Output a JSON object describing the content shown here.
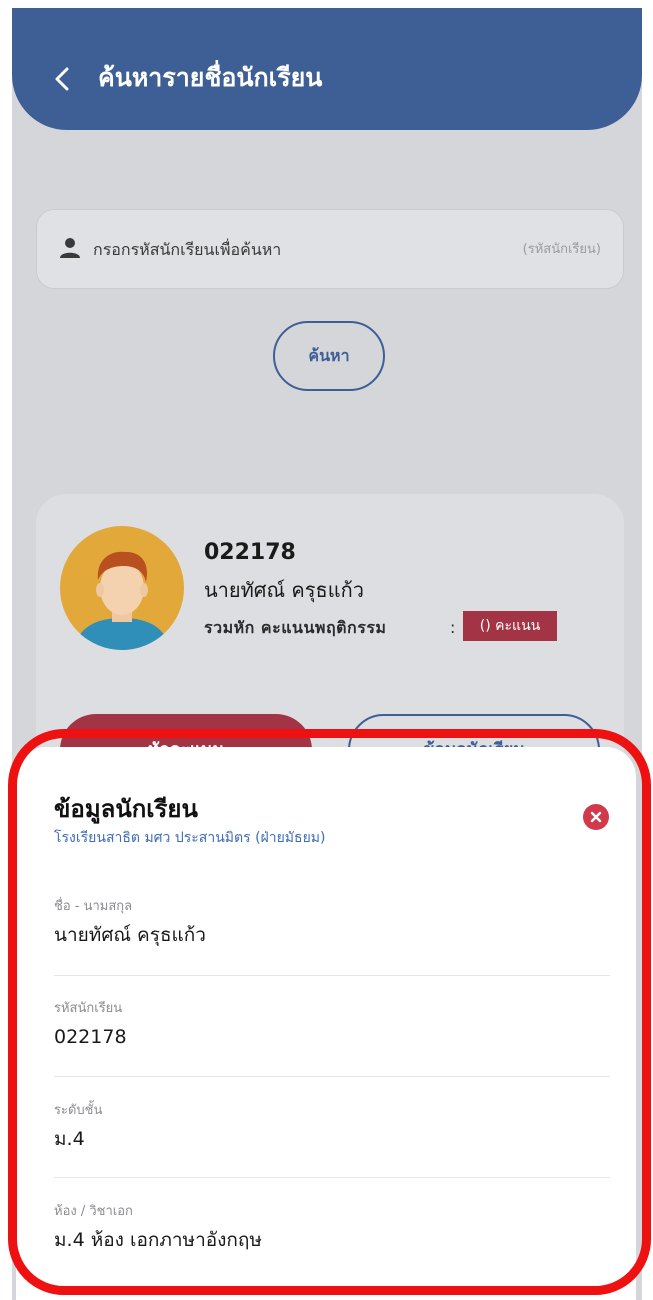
{
  "header": {
    "title": "ค้นหารายชื่อนักเรียน"
  },
  "search": {
    "placeholder": "กรอกรหัสนักเรียนเพื่อค้นหา",
    "hint": "(รหัสนักเรียน)",
    "button_label": "ค้นหา"
  },
  "student_card": {
    "id": "022178",
    "name": "นายทัศณ์ ครุธแก้ว",
    "total_label": "รวมหัก คะแนนพฤติกรรม",
    "separator": ":",
    "score_badge": "() คะแนน",
    "deduct_button_label": "หักคะแนน",
    "info_button_label": "ข้อมูลนักเรียน"
  },
  "info_sheet": {
    "title": "ข้อมูลนักเรียน",
    "school": "โรงเรียนสาธิต มศว ประสานมิตร (ฝ่ายมัธยม)",
    "fields": [
      {
        "label": "ชื่อ - นามสกุล",
        "value": "นายทัศณ์ ครุธแก้ว"
      },
      {
        "label": "รหัสนักเรียน",
        "value": "022178"
      },
      {
        "label": "ระดับชั้น",
        "value": "ม.4"
      },
      {
        "label": "ห้อง / วิชาเอก",
        "value": "ม.4 ห้อง เอกภาษาอังกฤษ"
      }
    ]
  },
  "colors": {
    "primary": "#3e5e96",
    "accent_red": "#a33446",
    "close_red": "#d23a4b",
    "link_blue": "#3e6cb8",
    "highlight_outline": "#ee1111"
  },
  "icons": {
    "back": "chevron-left-icon",
    "user": "person-icon",
    "avatar": "student-avatar",
    "close": "close-icon"
  }
}
